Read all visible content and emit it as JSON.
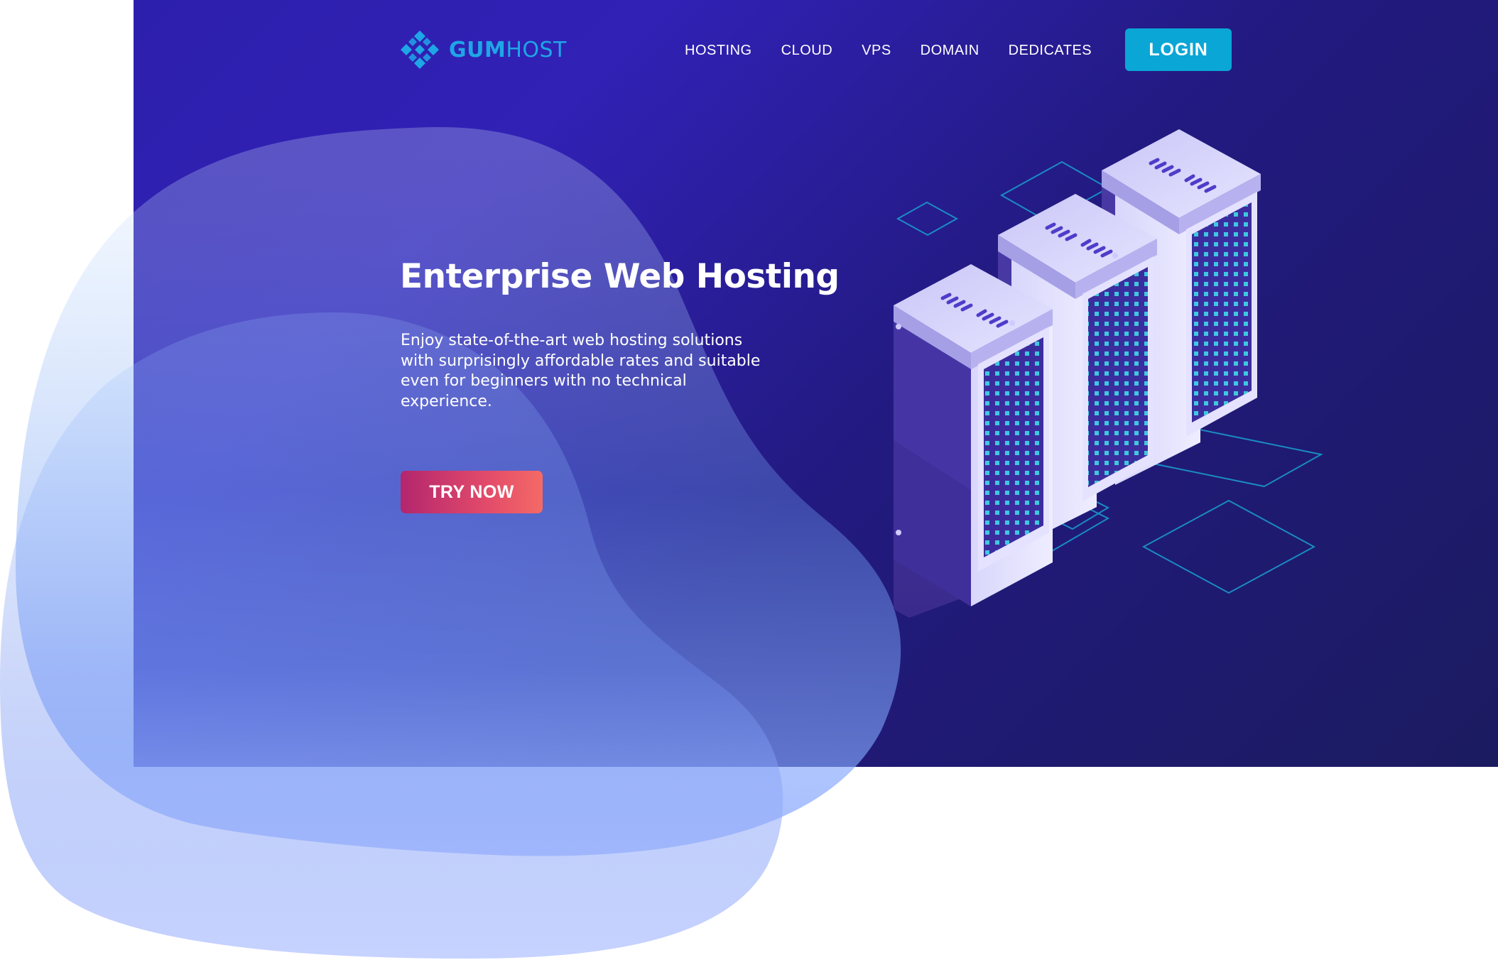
{
  "brand": {
    "name_bold": "GUM",
    "name_light": "HOST",
    "logo_icon": "diamond-grid-icon",
    "color": "#1ea6e6"
  },
  "nav": {
    "items": [
      {
        "label": "HOSTING"
      },
      {
        "label": "CLOUD"
      },
      {
        "label": "VPS"
      },
      {
        "label": "DOMAIN"
      },
      {
        "label": "DEDICATES"
      }
    ],
    "login_label": "LOGIN"
  },
  "hero": {
    "title": "Enterprise Web Hosting",
    "description": "Enjoy state-of-the-art web hosting solutions with surprisingly affordable rates and suitable even for beginners with no technical experience.",
    "cta_label": "TRY NOW",
    "illustration": "server-racks-icon"
  },
  "colors": {
    "hero_bg": "#2d1fad",
    "hero_bg_dark": "#1b1b60",
    "login_button": "#0aa6d6",
    "cta_gradient_start": "#b3266e",
    "cta_gradient_end": "#f46a66",
    "accent_teal": "#3fd9e6"
  }
}
